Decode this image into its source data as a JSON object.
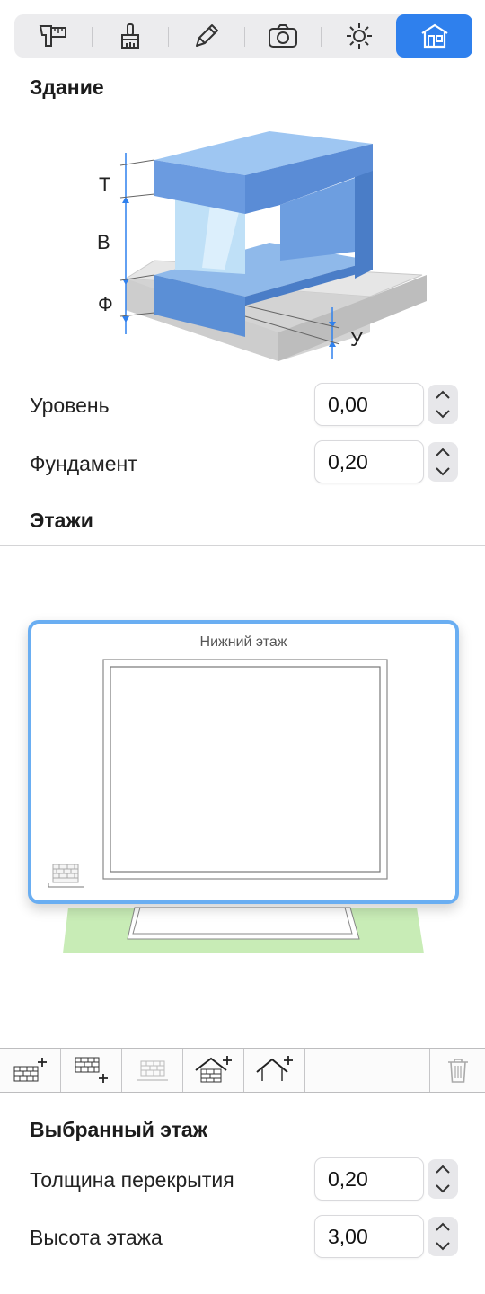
{
  "tabs": [
    {
      "icon": "caliper-ruler-icon",
      "label": "Измерения"
    },
    {
      "icon": "brush-icon",
      "label": "Кисть"
    },
    {
      "icon": "pencil-icon",
      "label": "Карандаш"
    },
    {
      "icon": "camera-icon",
      "label": "Камера"
    },
    {
      "icon": "sun-icon",
      "label": "Освещение"
    },
    {
      "icon": "building-icon",
      "label": "Здание",
      "active": true
    }
  ],
  "building": {
    "heading": "Здание",
    "diagram_labels": {
      "t": "Т",
      "v": "В",
      "f": "Ф",
      "u": "У"
    }
  },
  "level": {
    "label": "Уровень",
    "value": "0,00"
  },
  "foundation": {
    "label": "Фундамент",
    "value": "0,20"
  },
  "floors": {
    "heading": "Этажи",
    "card_title": "Нижний этаж"
  },
  "toolbar": {
    "icons": [
      "add-floor-above-icon",
      "add-floor-below-icon",
      "floor-disabled-icon",
      "add-roof-icon",
      "add-roof-outline-icon",
      "trash-icon"
    ]
  },
  "selected_floor": {
    "heading": "Выбранный этаж",
    "slab_thickness": {
      "label": "Толщина перекрытия",
      "value": "0,20"
    },
    "floor_height": {
      "label": "Высота этажа",
      "value": "3,00"
    }
  },
  "colors": {
    "accent": "#2f80ed",
    "building_blue": "#5b8fd6",
    "selection": "#6aaef2",
    "base_green": "#c8ecb6"
  }
}
